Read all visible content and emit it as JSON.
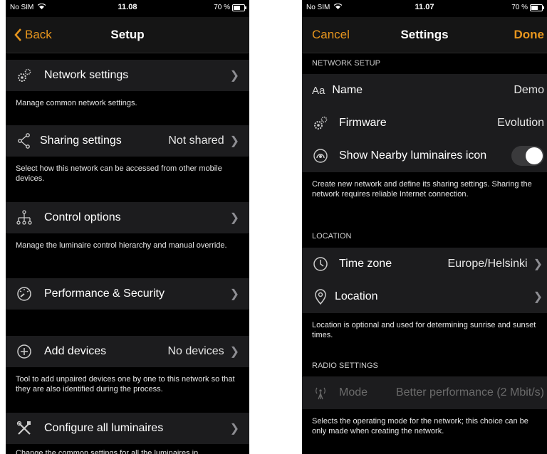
{
  "left": {
    "status": {
      "carrier": "No SIM",
      "time": "11.08",
      "battery": "70 %"
    },
    "nav": {
      "back": "Back",
      "title": "Setup"
    },
    "items": [
      {
        "label": "Network settings",
        "value": "",
        "desc": "Manage common network settings."
      },
      {
        "label": "Sharing settings",
        "value": "Not shared",
        "desc": "Select how this network can be accessed from other mobile devices."
      },
      {
        "label": "Control options",
        "value": "",
        "desc": "Manage the luminaire control hierarchy and manual override."
      },
      {
        "label": "Performance & Security",
        "value": "",
        "desc": ""
      },
      {
        "label": "Add devices",
        "value": "No devices",
        "desc": "Tool to add unpaired devices one by one to this network so that they are also identified during the process."
      },
      {
        "label": "Configure all luminaires",
        "value": "",
        "desc": "Change the common settings for all the luminaires in"
      }
    ]
  },
  "right": {
    "status": {
      "carrier": "No SIM",
      "time": "11.07",
      "battery": "70 %"
    },
    "nav": {
      "cancel": "Cancel",
      "title": "Settings",
      "done": "Done"
    },
    "network_header": "NETWORK SETUP",
    "name_icon": "Aa",
    "name_label": "Name",
    "name_value": "Demo",
    "firmware_label": "Firmware",
    "firmware_value": "Evolution",
    "nearby_label": "Show Nearby luminaires icon",
    "nearby_on": false,
    "network_desc": "Create new network and define its sharing settings. Sharing the network requires reliable Internet connection.",
    "location_header": "LOCATION",
    "timezone_label": "Time zone",
    "timezone_value": "Europe/Helsinki",
    "location_label": "Location",
    "location_desc": "Location is optional and used for determining sunrise and sunset times.",
    "radio_header": "RADIO SETTINGS",
    "mode_label": "Mode",
    "mode_value": "Better performance (2 Mbit/s)",
    "mode_desc": "Selects the operating mode for the network; this choice can be only made when creating the network."
  },
  "colors": {
    "accent": "#e8961e",
    "row_bg": "#1c1c1e",
    "bg": "#000000"
  },
  "icons": [
    "wifi-icon",
    "battery-icon",
    "chevron-left-icon",
    "gear-icon",
    "share-icon",
    "hierarchy-icon",
    "gauge-icon",
    "add-circle-icon",
    "tools-icon",
    "chevron-right-icon",
    "nearby-icon",
    "clock-icon",
    "location-pin-icon",
    "radio-icon"
  ]
}
